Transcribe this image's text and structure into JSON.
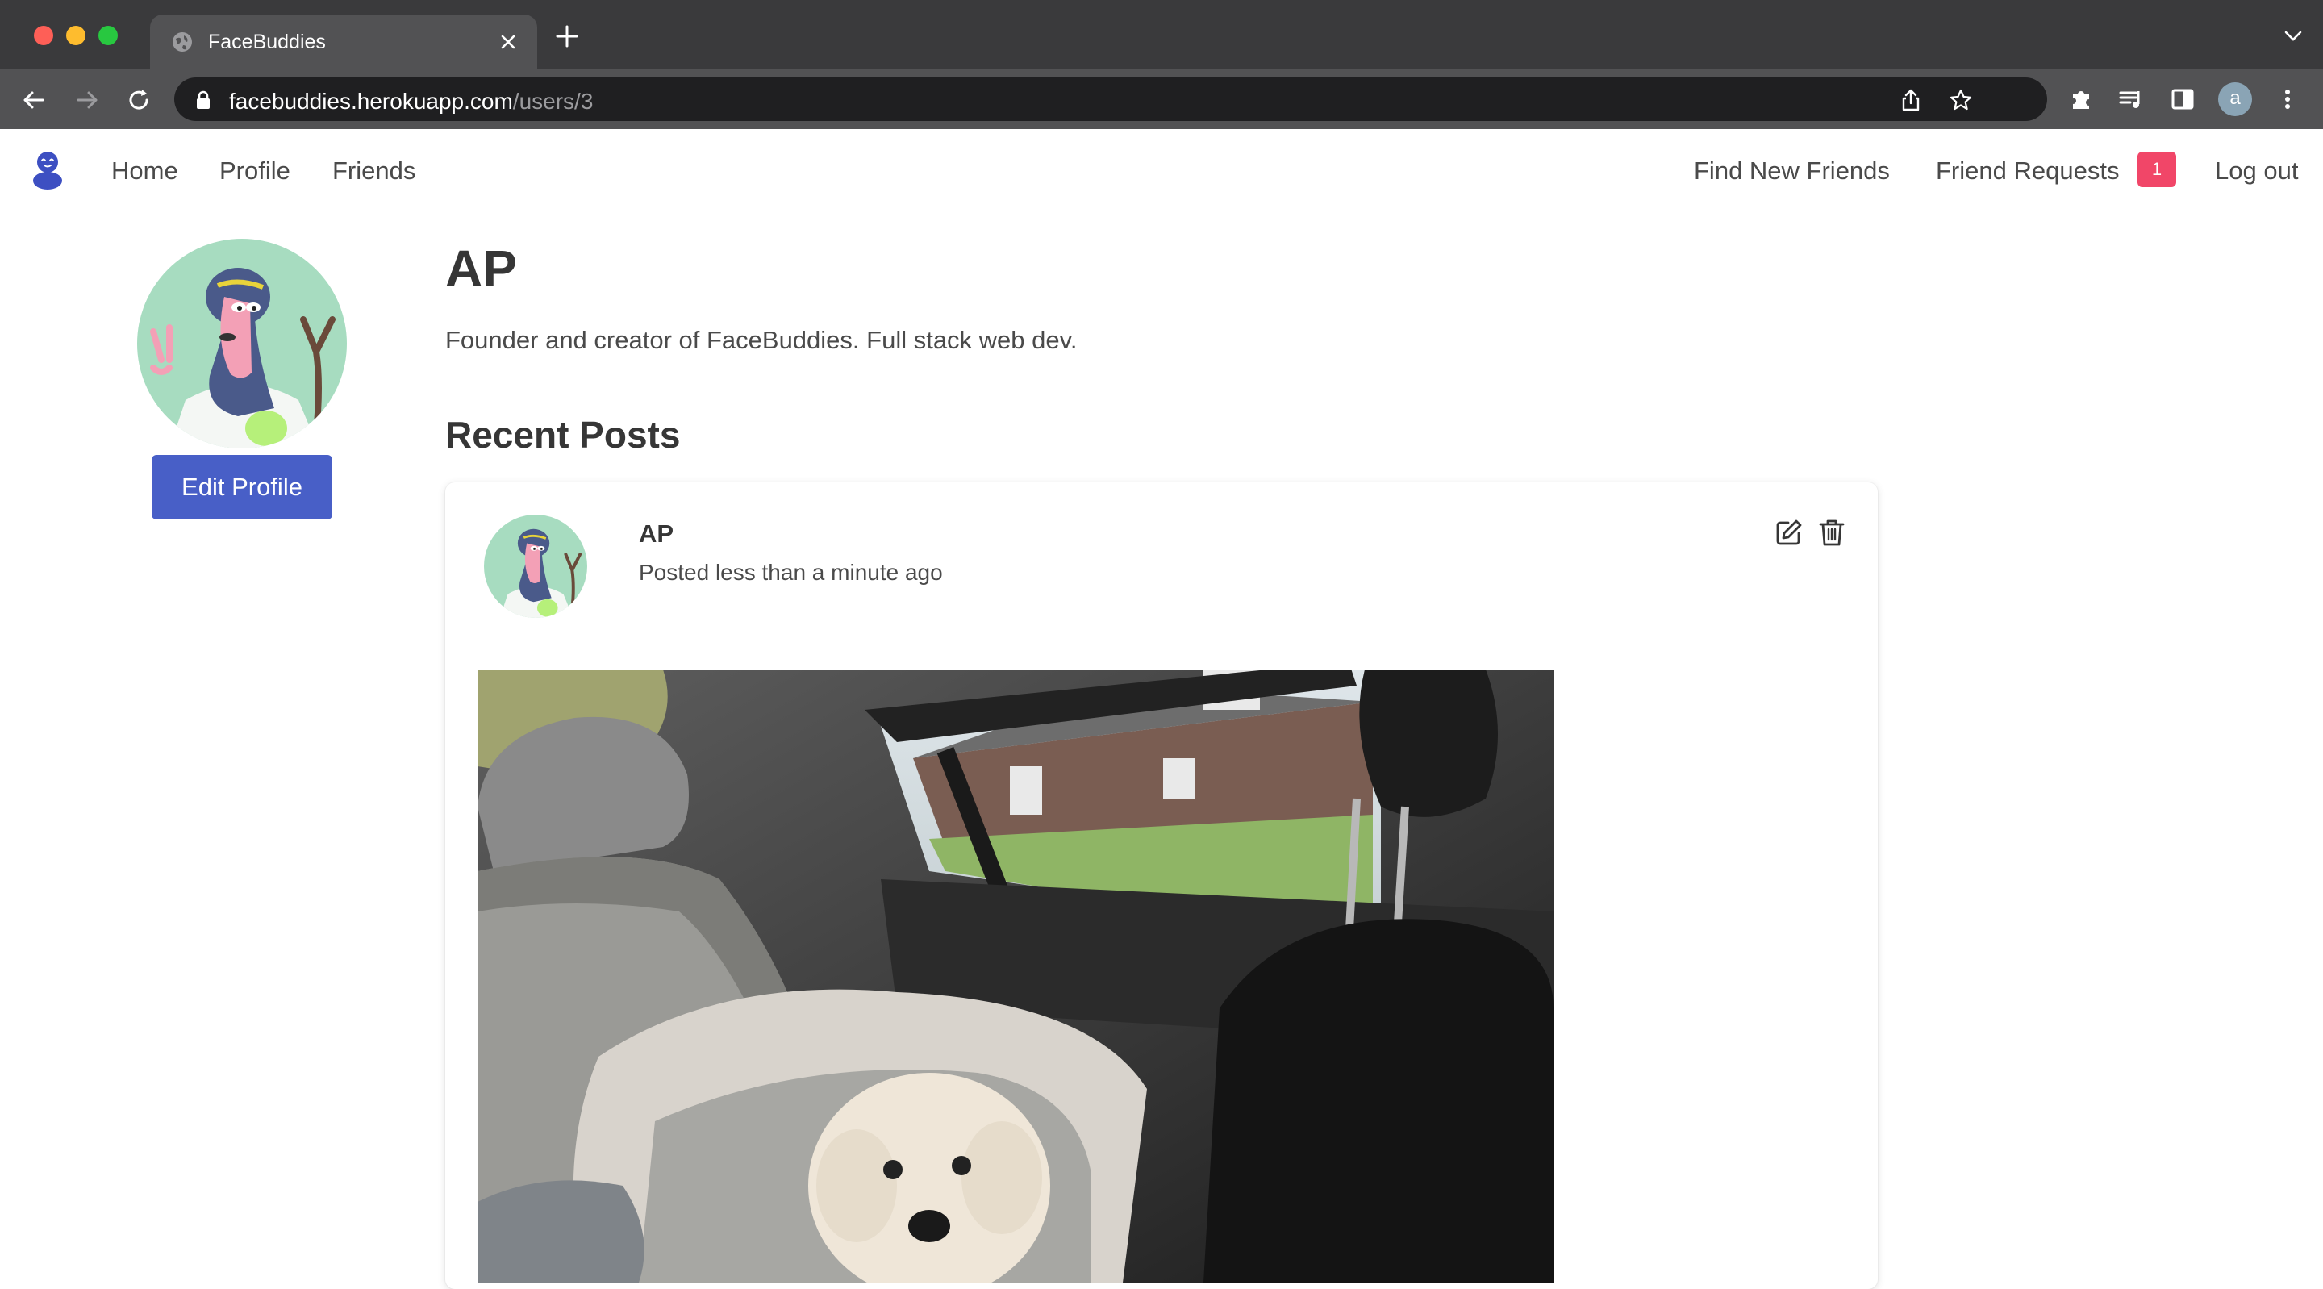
{
  "browser": {
    "tab_title": "FaceBuddies",
    "url_domain": "facebuddies.herokuapp.com",
    "url_path": "/users/3",
    "profile_initial": "a"
  },
  "nav": {
    "home": "Home",
    "profile": "Profile",
    "friends": "Friends",
    "find_new_friends": "Find New Friends",
    "friend_requests": "Friend Requests",
    "friend_requests_count": "1",
    "log_out": "Log out"
  },
  "profile": {
    "name": "AP",
    "bio": "Founder and creator of FaceBuddies. Full stack web dev.",
    "edit_button": "Edit Profile"
  },
  "posts_section": {
    "title": "Recent Posts",
    "posts": [
      {
        "author": "AP",
        "time": "Posted less than a minute ago"
      }
    ]
  },
  "colors": {
    "primary": "#485fc7",
    "danger_badge": "#f14668",
    "brand_icon": "#3d4fc2"
  },
  "icons": [
    "globe-icon",
    "close-icon",
    "plus-icon",
    "back-icon",
    "forward-icon",
    "reload-icon",
    "lock-icon",
    "share-icon",
    "star-icon",
    "extensions-icon",
    "media-icon",
    "sidepanel-icon",
    "more-icon",
    "edit-icon",
    "trash-icon"
  ]
}
